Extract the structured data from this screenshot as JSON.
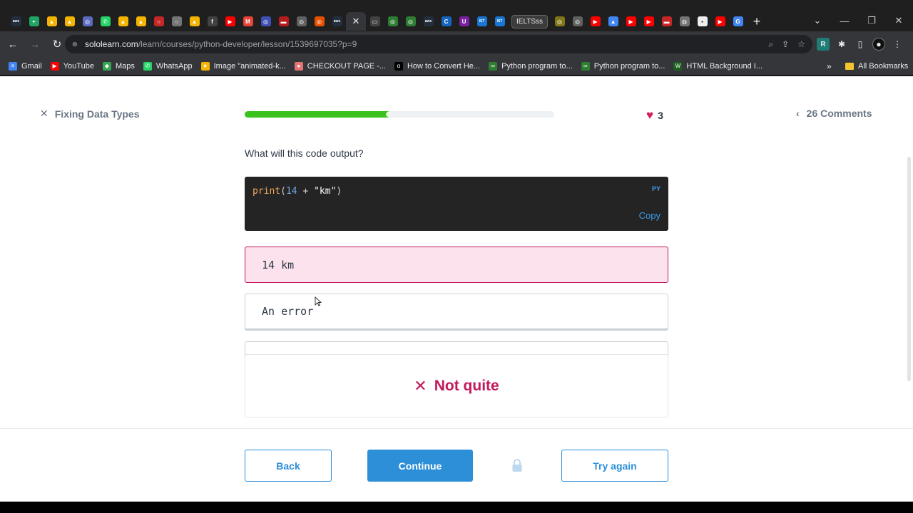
{
  "browser": {
    "tabs": [
      {
        "icon": "aws-icon",
        "color": "#232f3e",
        "glyph": "aws"
      },
      {
        "icon": "sheets-icon",
        "color": "#1fa463",
        "glyph": "+"
      },
      {
        "icon": "drive-icon",
        "color": "#f4b400",
        "glyph": "▲"
      },
      {
        "icon": "drive-icon",
        "color": "#f4b400",
        "glyph": "▲"
      },
      {
        "icon": "site-icon",
        "color": "#5c6bc0",
        "glyph": "◎"
      },
      {
        "icon": "whatsapp-icon",
        "color": "#25d366",
        "glyph": "✆"
      },
      {
        "icon": "drive-icon",
        "color": "#f4b400",
        "glyph": "▲"
      },
      {
        "icon": "drive-icon",
        "color": "#f4b400",
        "glyph": "▲"
      },
      {
        "icon": "circle-icon",
        "color": "#c62828",
        "glyph": "○"
      },
      {
        "icon": "circle-icon",
        "color": "#757575",
        "glyph": "○"
      },
      {
        "icon": "drive-icon",
        "color": "#f4b400",
        "glyph": "▲"
      },
      {
        "icon": "app-icon",
        "color": "#424242",
        "glyph": "f"
      },
      {
        "icon": "youtube-icon",
        "color": "#ff0000",
        "glyph": "▶"
      },
      {
        "icon": "gmail-icon",
        "color": "#ea4335",
        "glyph": "M"
      },
      {
        "icon": "site-icon",
        "color": "#3f51b5",
        "glyph": "◎"
      },
      {
        "icon": "site-icon",
        "color": "#b71c1c",
        "glyph": "▬"
      },
      {
        "icon": "site-icon",
        "color": "#616161",
        "glyph": "◎"
      },
      {
        "icon": "site-icon",
        "color": "#e65100",
        "glyph": "◎"
      },
      {
        "icon": "aws-icon",
        "color": "#232f3e",
        "glyph": "aws"
      }
    ],
    "tabs_after": [
      {
        "icon": "site-icon",
        "color": "#424242",
        "glyph": "▭"
      },
      {
        "icon": "site-icon",
        "color": "#2e7d32",
        "glyph": "◎"
      },
      {
        "icon": "site-icon",
        "color": "#2e7d32",
        "glyph": "◎"
      },
      {
        "icon": "aws-icon",
        "color": "#232f3e",
        "glyph": "aws"
      },
      {
        "icon": "c-icon",
        "color": "#1565c0",
        "glyph": "C"
      },
      {
        "icon": "site-icon",
        "color": "#7b1fa2",
        "glyph": "U"
      },
      {
        "icon": "ist-icon",
        "color": "#1976d2",
        "glyph": "IST"
      },
      {
        "icon": "ist-icon",
        "color": "#1976d2",
        "glyph": "IST"
      }
    ],
    "tab_label": "IELTSss",
    "tabs_end": [
      {
        "icon": "site-icon",
        "color": "#827717",
        "glyph": "◎"
      },
      {
        "icon": "site-icon",
        "color": "#616161",
        "glyph": "◎"
      },
      {
        "icon": "youtube-icon",
        "color": "#ff0000",
        "glyph": "▶"
      },
      {
        "icon": "drive-icon",
        "color": "#4285f4",
        "glyph": "▲"
      },
      {
        "icon": "youtube-icon",
        "color": "#ff0000",
        "glyph": "▶"
      },
      {
        "icon": "youtube-icon",
        "color": "#ff0000",
        "glyph": "▶"
      },
      {
        "icon": "site-icon",
        "color": "#c62828",
        "glyph": "▬"
      },
      {
        "icon": "globe-icon",
        "color": "#757575",
        "glyph": "◍"
      },
      {
        "icon": "site-icon",
        "color": "#eeeeee",
        "glyph": "▪"
      },
      {
        "icon": "youtube-icon",
        "color": "#ff0000",
        "glyph": "▶"
      },
      {
        "icon": "google-icon",
        "color": "#4285f4",
        "glyph": "G"
      }
    ],
    "url_host": "sololearn.com",
    "url_path": "/learn/courses/python-developer/lesson/1539697035?p=9",
    "bookmarks": [
      {
        "label": "Gmail",
        "color": "#4285f4",
        "glyph": "≡"
      },
      {
        "label": "YouTube",
        "color": "#ff0000",
        "glyph": "▶"
      },
      {
        "label": "Maps",
        "color": "#34a853",
        "glyph": "◆"
      },
      {
        "label": "WhatsApp",
        "color": "#25d366",
        "glyph": "✆"
      },
      {
        "label": "Image \"animated-k...",
        "color": "#f4b400",
        "glyph": "★"
      },
      {
        "label": "CHECKOUT PAGE -...",
        "color": "#e57373",
        "glyph": "●"
      },
      {
        "label": "How to Convert He...",
        "color": "#000000",
        "glyph": "α"
      },
      {
        "label": "Python program to...",
        "color": "#2e7d32",
        "glyph": "∞"
      },
      {
        "label": "Python program to...",
        "color": "#2e7d32",
        "glyph": "∞"
      },
      {
        "label": "HTML Background I...",
        "color": "#1b5e20",
        "glyph": "W"
      }
    ],
    "bookmarks_more": "»",
    "all_bookmarks": "All Bookmarks"
  },
  "lesson": {
    "title": "Fixing Data Types",
    "progress_fraction": 0.47,
    "lives": "3",
    "comments": "26 Comments",
    "question": "What will this code output?",
    "code": {
      "fn": "print",
      "open": "(",
      "num": "14",
      "op": " + ",
      "str": "\"km\"",
      "close": ")"
    },
    "lang": "PY",
    "copy": "Copy",
    "options": [
      "14 km",
      "An error",
      ""
    ],
    "feedback": "Not quite",
    "buttons": {
      "back": "Back",
      "continue": "Continue",
      "try_again": "Try again"
    }
  },
  "colors": {
    "accent": "#2c8fd8",
    "error": "#c2185b",
    "progress": "#3cc21e"
  }
}
